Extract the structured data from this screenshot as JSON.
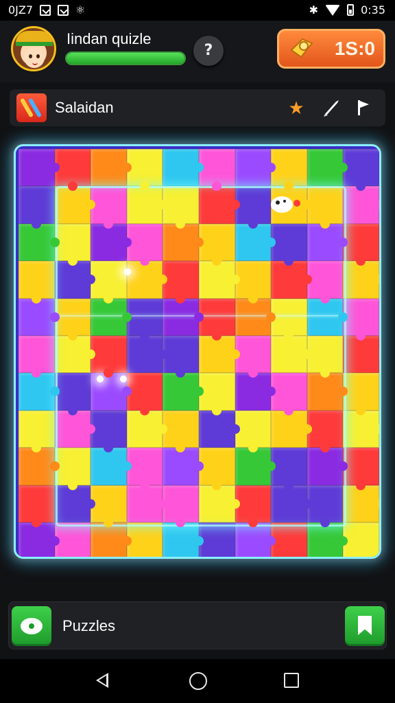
{
  "status_bar": {
    "left_text": "0JZ7",
    "time": "0:35",
    "cloud_glyph": "⚛"
  },
  "header": {
    "title": "Iindan quizle",
    "progress_fraction": 1.0,
    "help_label": "?",
    "timer_value": "1S:0",
    "timer_icon": "coin-icon"
  },
  "level": {
    "label": "Salaidan",
    "icons": [
      "lightning-icon",
      "star-icon",
      "rocket-icon",
      "flag-icon"
    ]
  },
  "board": {
    "rows": 11,
    "cols": 10,
    "palette": [
      "#8a2be2",
      "#ffd21a",
      "#2fc7f0",
      "#ff3a3a",
      "#37c837",
      "#ff55d8",
      "#ff8a1a",
      "#5e3bd6",
      "#9b4bff",
      "#f8f032"
    ]
  },
  "bottom_bar": {
    "label": "Puzzles",
    "left_icon": "eye-icon",
    "right_icon": "bookmark-icon"
  },
  "nav": {
    "back": "back-icon",
    "home": "home-icon",
    "recents": "recents-icon"
  }
}
